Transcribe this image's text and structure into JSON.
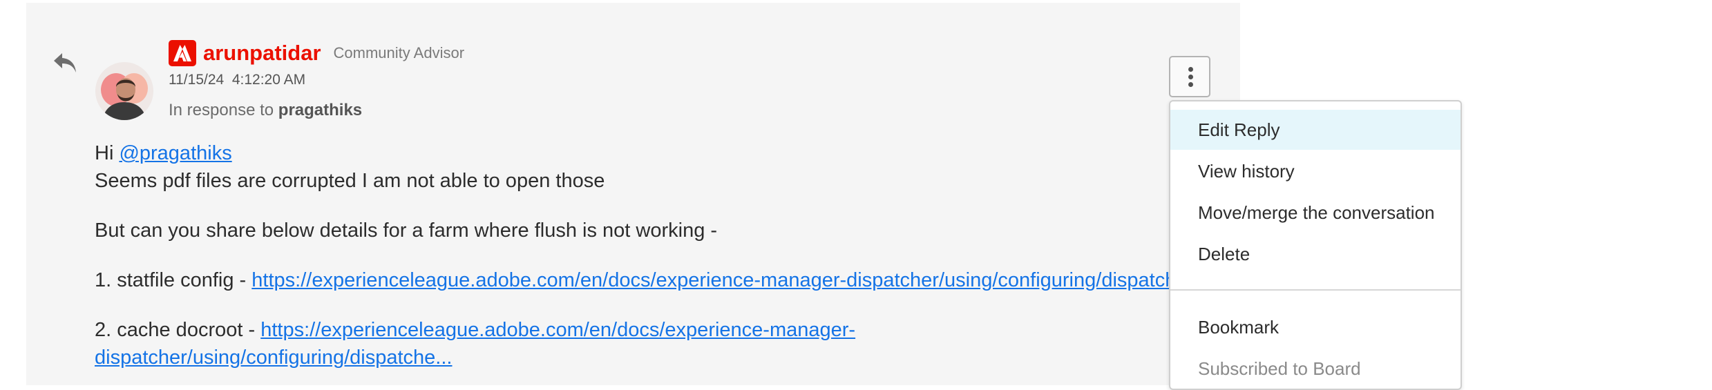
{
  "post": {
    "author": {
      "name": "arunpatidar",
      "role": "Community Advisor",
      "brand_color": "#eb1000"
    },
    "timestamp": "11/15/24  4:12:20 AM",
    "in_response": {
      "prefix": "In response to",
      "user": "pragathiks"
    },
    "body": {
      "greeting": "Hi",
      "mention": "@pragathiks",
      "line1": "Seems pdf files are corrupted I am not able to open those",
      "line2": "But can you share below details for a farm where flush is not working -",
      "item1_label": "1. statfile config -",
      "item1_link": "https://experienceleague.adobe.com/en/docs/experience-manager-dispatcher/using/configuring/dispatcher-configuration",
      "item2_label": "2. cache docroot -",
      "item2_link_line1": "https://experienceleague.adobe.com/en/docs/experience-manager-",
      "item2_link_line2": "dispatcher/using/configuring/dispatche..."
    },
    "icons": {
      "reply": "reply-arrow-icon",
      "brand": "adobe-logo-icon",
      "more": "more-vertical-icon"
    },
    "link_color": "#1473e6"
  },
  "menu": {
    "items": [
      {
        "label": "Edit Reply"
      },
      {
        "label": "View history"
      },
      {
        "label": "Move/merge the conversation"
      },
      {
        "label": "Delete"
      },
      {
        "label": "Bookmark"
      },
      {
        "label": "Subscribed to Board"
      }
    ],
    "highlight_color": "#e5f6fb"
  }
}
